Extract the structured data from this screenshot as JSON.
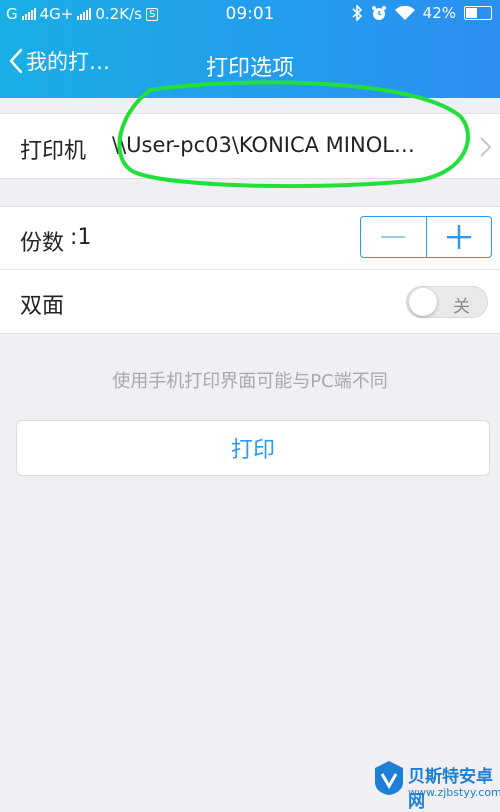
{
  "status_bar": {
    "carrier": "G",
    "network": "4G+",
    "speed": "0.2K/s",
    "s_icon": "S",
    "time": "09:01",
    "battery": "42%",
    "battery_level": 0.42
  },
  "navbar": {
    "back_label": "我的打…",
    "title": "打印选项"
  },
  "printer_row": {
    "label": "打印机",
    "value": "\\\\User-pc03\\KONICA MINOL…"
  },
  "copies_row": {
    "label": "份数",
    "separator": ":",
    "value": "1"
  },
  "duplex_row": {
    "label": "双面",
    "toggle_state": "关",
    "enabled": false
  },
  "hint": "使用手机打印界面可能与PC端不同",
  "print_button": "打印",
  "watermark": {
    "name": "贝斯特安卓网",
    "url": "www.zjbstyy.com"
  },
  "colors": {
    "header_start": "#19aee6",
    "header_end": "#2c8ff2",
    "accent": "#2b9af3",
    "marker": "#22e03a"
  },
  "icons": [
    "signal-icon",
    "bluetooth-icon",
    "alarm-icon",
    "wifi-icon",
    "battery-icon",
    "chevron-left-icon",
    "chevron-right-icon",
    "minus-icon",
    "plus-icon"
  ]
}
